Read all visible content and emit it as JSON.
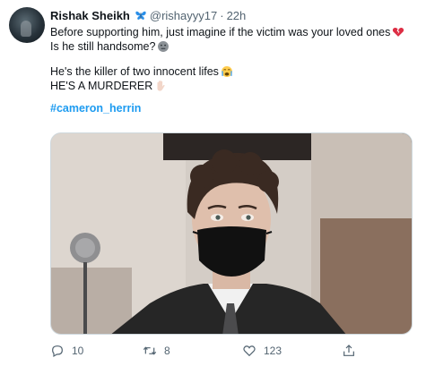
{
  "tweet": {
    "author_name": "Rishak Sheikh",
    "author_badge_icon": "butterfly-icon",
    "handle": "@rishayyy17",
    "separator": "·",
    "time": "22h",
    "lines": [
      "Before supporting him, just imagine if the victim was your loved ones",
      "Is he still handsome?",
      "He's the killer of two innocent lifes",
      "HE'S A MURDERER"
    ],
    "hashtag": "#cameron_herrin",
    "media_alt": "photo",
    "colors": {
      "link": "#1d9bf0",
      "muted": "#536471",
      "text": "#0f1419"
    }
  },
  "actions": {
    "reply_count": "10",
    "retweet_count": "8",
    "like_count": "123"
  }
}
